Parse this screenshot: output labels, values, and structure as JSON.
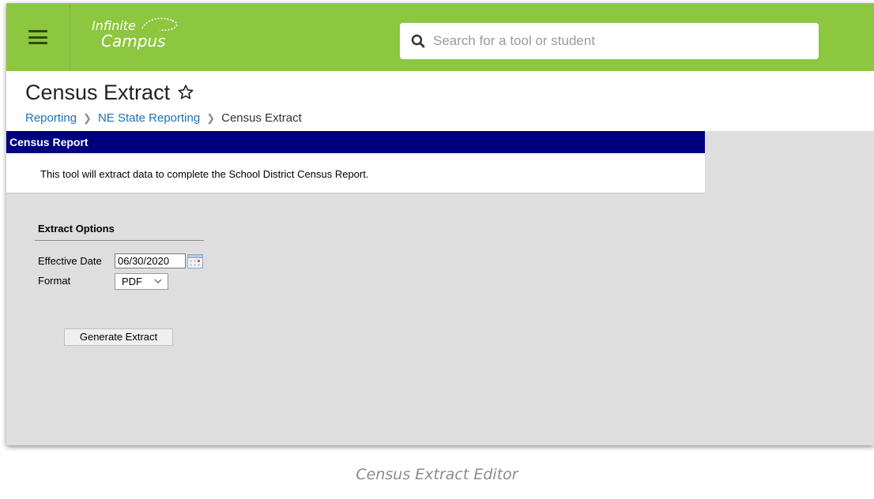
{
  "header": {
    "logo_line1": "Infinite",
    "logo_line2": "Campus",
    "search_placeholder": "Search for a tool or student",
    "search_value": ""
  },
  "page": {
    "title": "Census Extract",
    "breadcrumb": [
      "Reporting",
      "NE State Reporting",
      "Census Extract"
    ]
  },
  "panel": {
    "heading": "Census Report",
    "description": "This tool will extract data to complete the School District Census Report."
  },
  "extract_options": {
    "title": "Extract Options",
    "effective_date_label": "Effective Date",
    "effective_date_value": "06/30/2020",
    "format_label": "Format",
    "format_value": "PDF",
    "generate_button": "Generate Extract"
  },
  "caption": "Census Extract Editor",
  "colors": {
    "header_green": "#8dc63f",
    "panel_header_blue": "#00007f",
    "link_blue": "#1f6fb4",
    "content_gray": "#dedede"
  }
}
